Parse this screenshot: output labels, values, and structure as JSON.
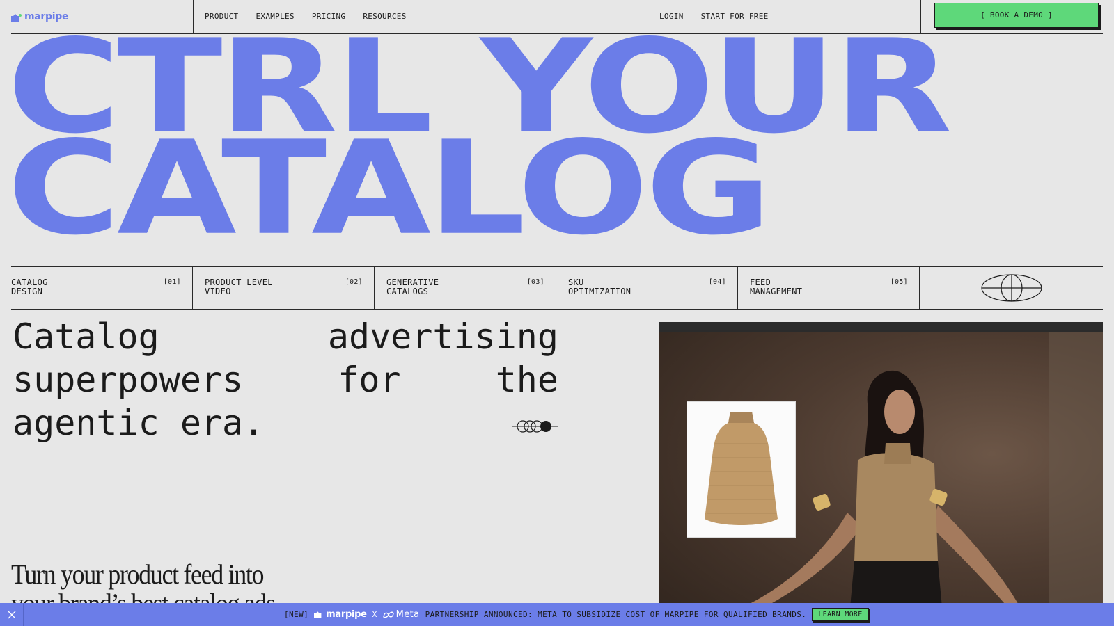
{
  "nav": {
    "logo_text": "marpipe",
    "links": [
      "PRODUCT",
      "EXAMPLES",
      "PRICING",
      "RESOURCES"
    ],
    "login": "LOGIN",
    "start_free": "START FOR FREE",
    "book_demo": "[ BOOK A DEMO ]"
  },
  "hero": {
    "line1": "CTRL YOUR",
    "line2": "CATALOG"
  },
  "features": [
    {
      "label": "CATALOG\nDESIGN",
      "num": "[01]"
    },
    {
      "label": "PRODUCT LEVEL\nVIDEO",
      "num": "[02]"
    },
    {
      "label": "GENERATIVE\nCATALOGS",
      "num": "[03]"
    },
    {
      "label": "SKU\nOPTIMIZATION",
      "num": "[04]"
    },
    {
      "label": "FEED\nMANAGEMENT",
      "num": "[05]"
    }
  ],
  "tagline": "Catalog advertising superpowers for the agentic era.",
  "subheading": "Turn your product feed into your brand’s best catalog ads.",
  "banner": {
    "tag": "[NEW]",
    "logo_text": "marpipe",
    "x": "X",
    "meta_text": "Meta",
    "message": "PARTNERSHIP ANNOUNCED: META TO SUBSIDIZE COST OF MARPIPE FOR QUALIFIED BRANDS.",
    "cta": "LEARN MORE"
  },
  "colors": {
    "accent": "#6b7de8",
    "cta_green": "#5ed87a",
    "background": "#e7e7e7",
    "ink": "#1b1b1b"
  }
}
